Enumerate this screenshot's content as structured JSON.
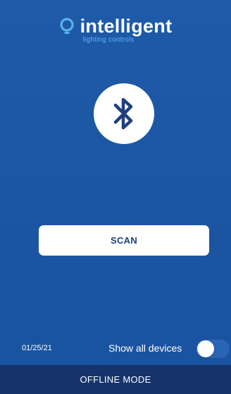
{
  "brand": {
    "name": "intelligent",
    "tagline": "lighting controls",
    "logo_icon": "lightbulb-icon"
  },
  "bluetooth": {
    "icon": "bluetooth-icon"
  },
  "scan_button": {
    "label": "SCAN"
  },
  "bottom_bar": {
    "date": "01/25/21",
    "show_all_label": "Show all devices",
    "show_all_enabled": false
  },
  "footer": {
    "label": "OFFLINE MODE"
  },
  "colors": {
    "background": "#1f5aa6",
    "footer": "#16346b",
    "tagline": "#59b4ea",
    "button_text": "#1f3f7d"
  }
}
